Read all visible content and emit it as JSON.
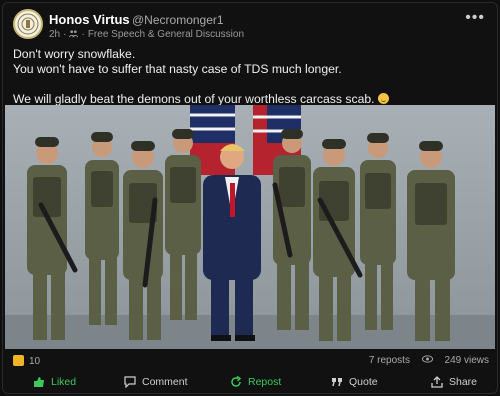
{
  "user": {
    "name": "Honos Virtus",
    "handle": "@Necromonger1",
    "time": "2h",
    "dot": "·",
    "forum": "Free Speech & General Discussion"
  },
  "post": {
    "line1": "Don't worry snowflake.",
    "line2": "You won't have to suffer that nasty case of TDS much longer.",
    "line3": "We will gladly beat the demons out of your worthless carcass scab."
  },
  "stats": {
    "likes": "10",
    "reposts": "7 reposts",
    "views": "249 views"
  },
  "actions": {
    "liked": "Liked",
    "comment": "Comment",
    "repost": "Repost",
    "quote": "Quote",
    "share": "Share"
  },
  "menu": {
    "more": "•••"
  },
  "colors": {
    "accent_green": "#3cc85c",
    "like_yellow": "#f1b429"
  }
}
